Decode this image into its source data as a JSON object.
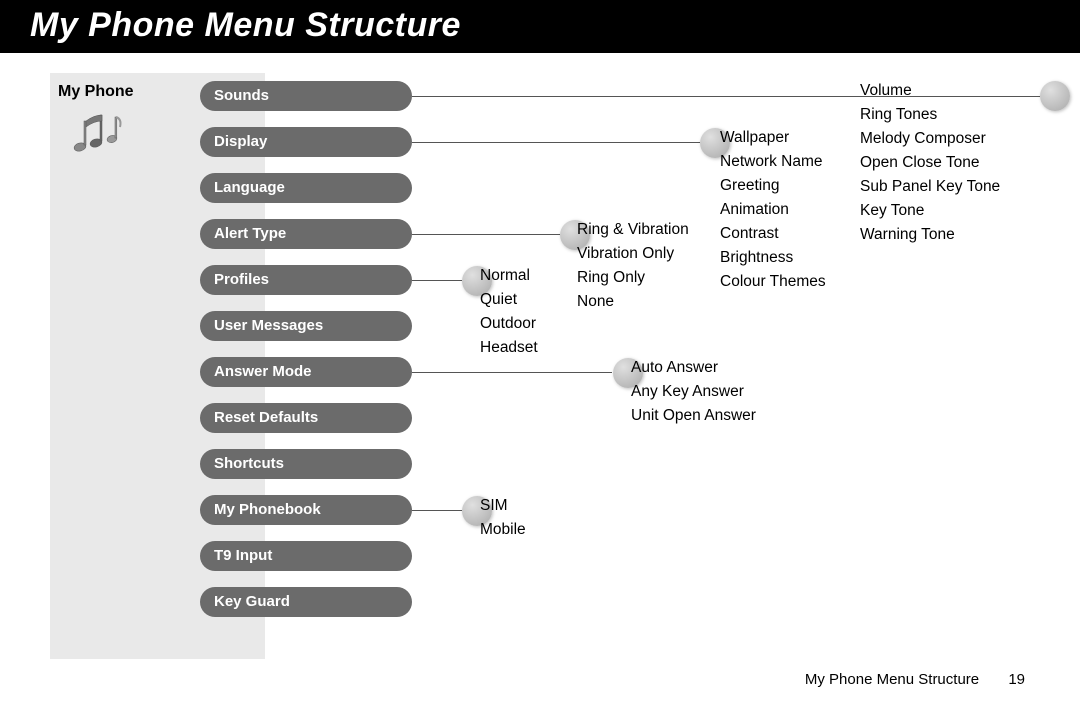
{
  "header": {
    "title": "My Phone Menu Structure"
  },
  "sidebar": {
    "title": "My Phone"
  },
  "menu": {
    "items": [
      "Sounds",
      "Display",
      "Language",
      "Alert Type",
      "Profiles",
      "User Messages",
      "Answer Mode",
      "Reset Defaults",
      "Shortcuts",
      "My Phonebook",
      "T9 Input",
      "Key Guard"
    ]
  },
  "sounds_sub": {
    "items": [
      "Volume",
      "Ring Tones",
      "Melody Composer",
      "Open Close Tone",
      "Sub Panel Key Tone",
      "Key Tone",
      "Warning Tone"
    ]
  },
  "display_sub": {
    "items": [
      "Wallpaper",
      "Network Name",
      "Greeting",
      "Animation",
      "Contrast",
      "Brightness",
      "Colour Themes"
    ]
  },
  "alert_sub": {
    "items": [
      "Ring & Vibration",
      "Vibration Only",
      "Ring Only",
      "None"
    ]
  },
  "profiles_sub": {
    "items": [
      "Normal",
      "Quiet",
      "Outdoor",
      "Headset"
    ]
  },
  "answer_sub": {
    "items": [
      "Auto Answer",
      "Any Key Answer",
      "Unit Open Answer"
    ]
  },
  "phonebook_sub": {
    "items": [
      "SIM",
      "Mobile"
    ]
  },
  "footer": {
    "text": "My Phone Menu Structure",
    "page": "19"
  }
}
